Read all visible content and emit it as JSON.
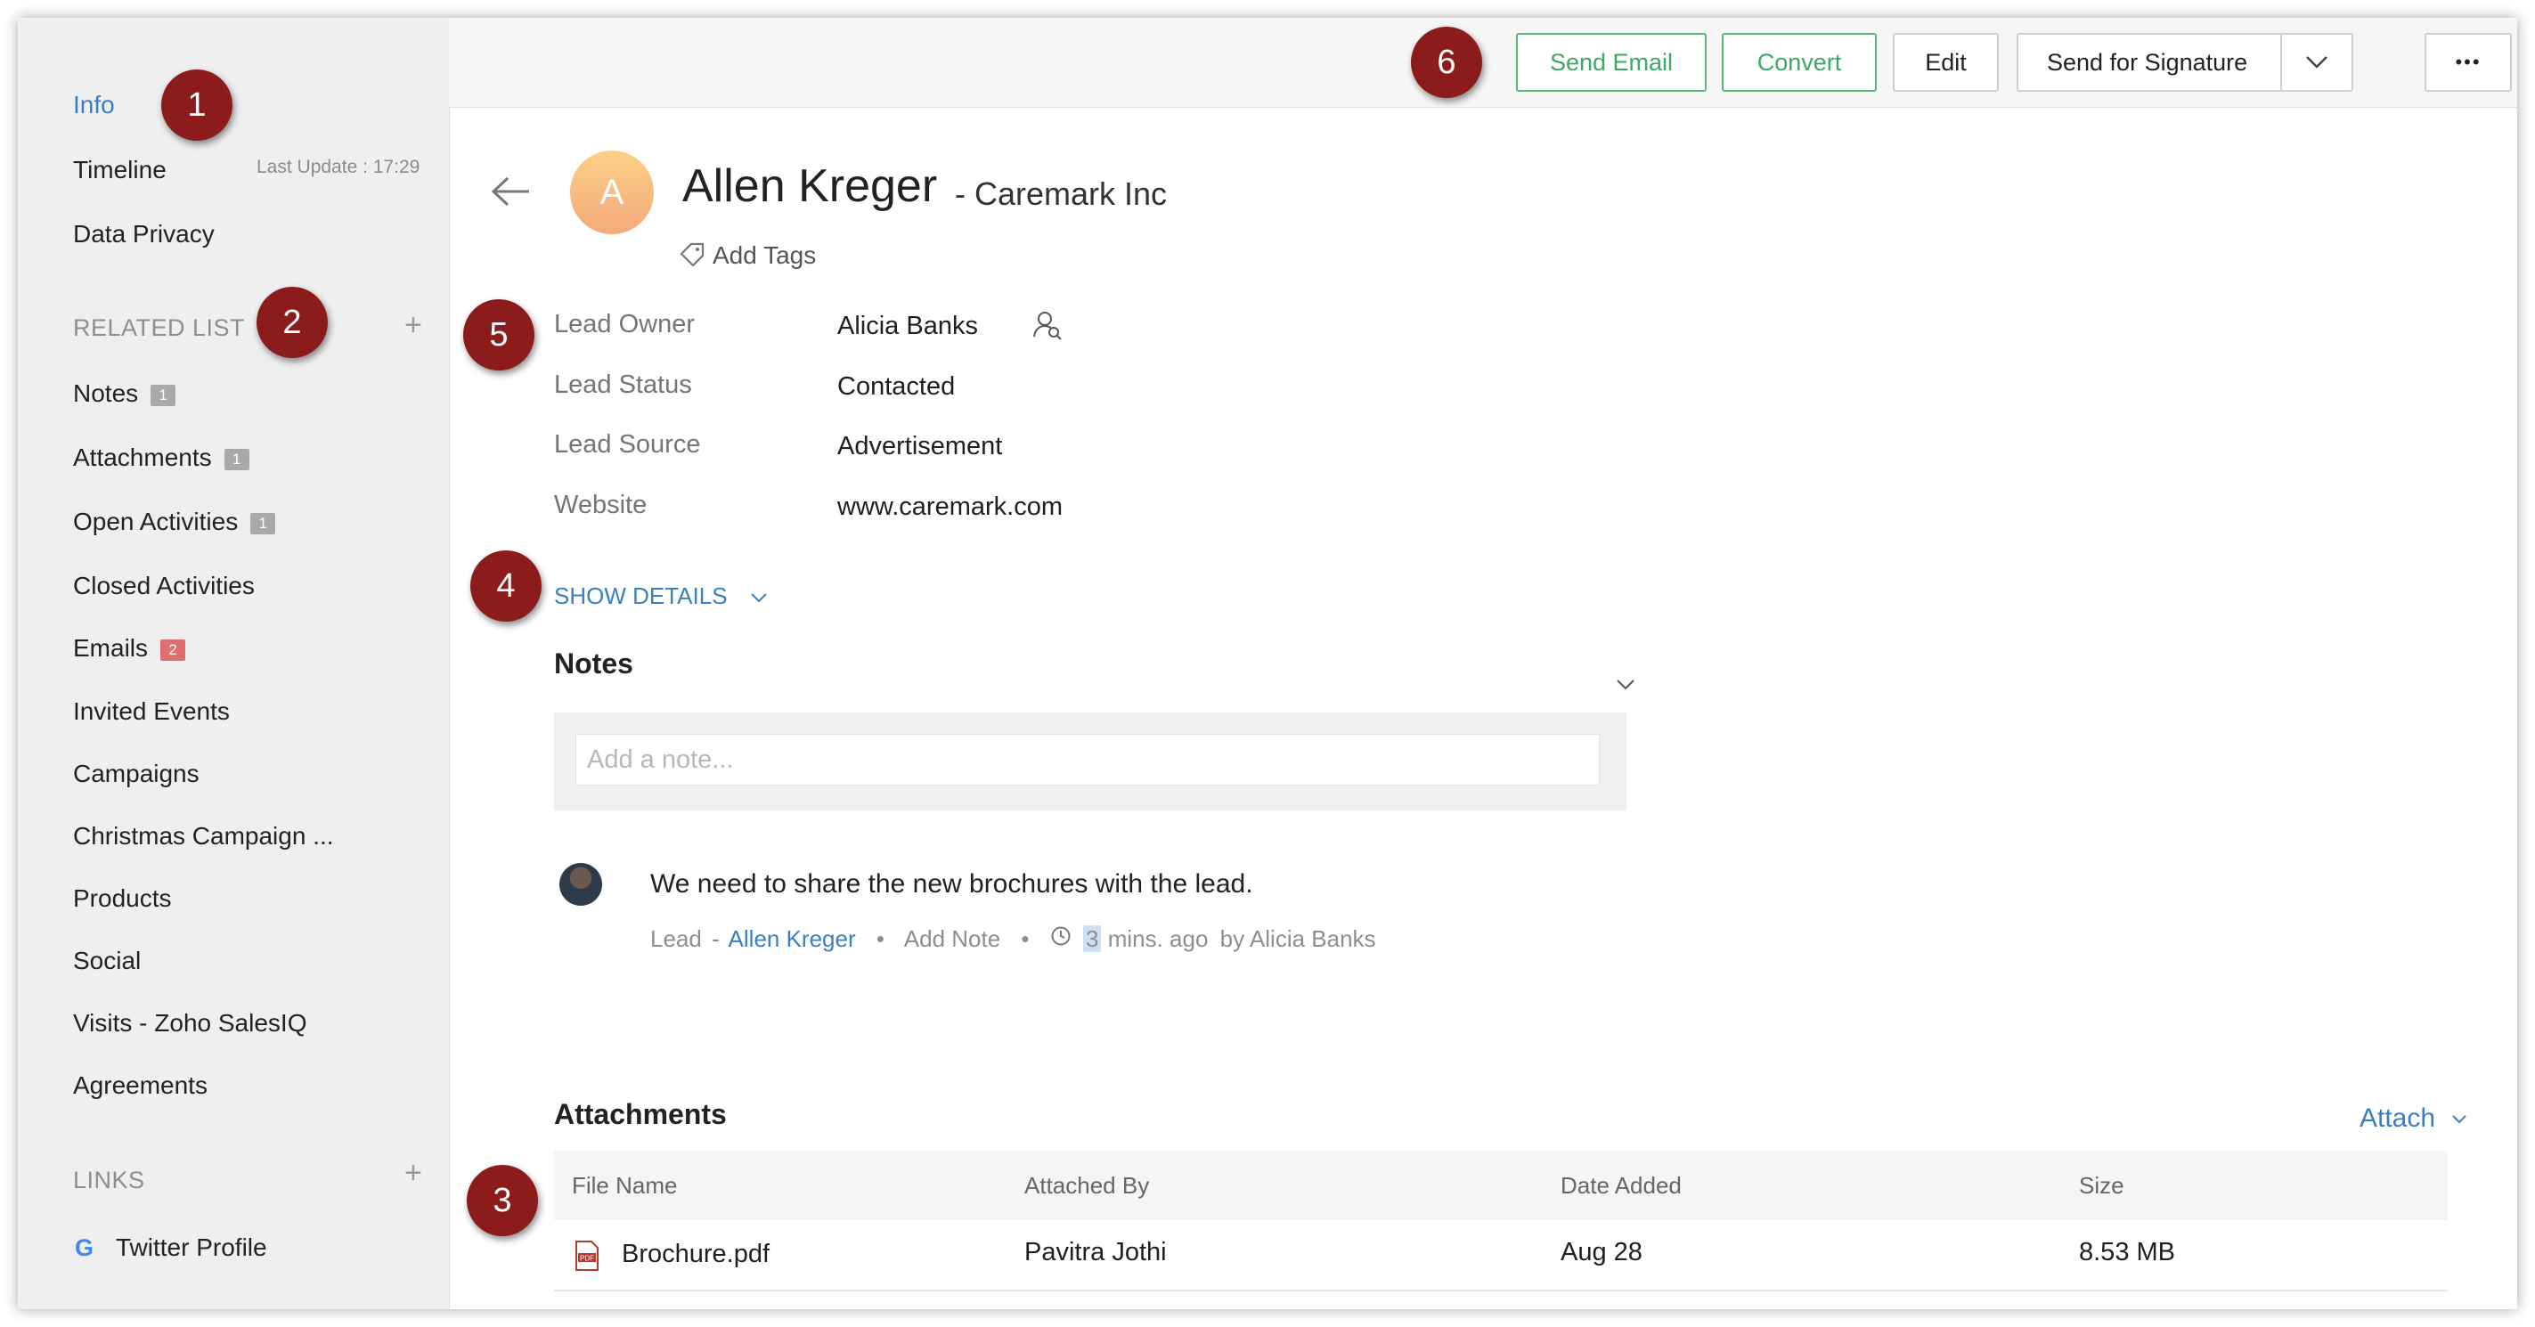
{
  "sidebar": {
    "nav": [
      {
        "label": "Info",
        "active": true
      },
      {
        "label": "Timeline"
      },
      {
        "label": "Data Privacy"
      }
    ],
    "last_update": "Last Update : 17:29",
    "related_heading": "RELATED LIST",
    "related": [
      {
        "label": "Notes",
        "count": "1"
      },
      {
        "label": "Attachments",
        "count": "1"
      },
      {
        "label": "Open Activities",
        "count": "1"
      },
      {
        "label": "Closed Activities"
      },
      {
        "label": "Emails",
        "count": "2"
      },
      {
        "label": "Invited Events"
      },
      {
        "label": "Campaigns"
      },
      {
        "label": "Christmas Campaign ..."
      },
      {
        "label": "Products"
      },
      {
        "label": "Social"
      },
      {
        "label": "Visits - Zoho SalesIQ"
      },
      {
        "label": "Agreements"
      }
    ],
    "links_heading": "LINKS",
    "links": [
      {
        "label": "Twitter Profile",
        "icon": "google-icon"
      }
    ]
  },
  "toolbar": {
    "send_email": "Send Email",
    "convert": "Convert",
    "edit": "Edit",
    "send_signature": "Send for Signature",
    "more": "•••"
  },
  "record": {
    "avatar_letter": "A",
    "name": "Allen Kreger",
    "company": "- Caremark Inc",
    "add_tags": "Add Tags",
    "fields": [
      {
        "label": "Lead Owner",
        "value": "Alicia Banks"
      },
      {
        "label": "Lead Status",
        "value": "Contacted"
      },
      {
        "label": "Lead Source",
        "value": "Advertisement"
      },
      {
        "label": "Website",
        "value": "www.caremark.com"
      }
    ],
    "show_details": "SHOW DETAILS"
  },
  "notes": {
    "heading": "Notes",
    "placeholder": "Add a note...",
    "entry": {
      "text": "We need to share the new brochures with the lead.",
      "type": "Lead",
      "dash": "-",
      "record_link": "Allen Kreger",
      "action": "Add Note",
      "time_num": "3",
      "time_rest": "mins. ago",
      "by": "by",
      "author": "Alicia Banks"
    }
  },
  "attachments": {
    "heading": "Attachments",
    "attach_label": "Attach",
    "columns": [
      "File Name",
      "Attached By",
      "Date Added",
      "Size"
    ],
    "rows": [
      {
        "file": "Brochure.pdf",
        "by": "Pavitra Jothi",
        "date": "Aug 28",
        "size": "8.53 MB"
      }
    ]
  },
  "callouts": [
    "1",
    "2",
    "3",
    "4",
    "5",
    "6"
  ],
  "colors": {
    "accent": "#3a7fc1",
    "green": "#3ea865",
    "callout": "#8c1c1c"
  }
}
